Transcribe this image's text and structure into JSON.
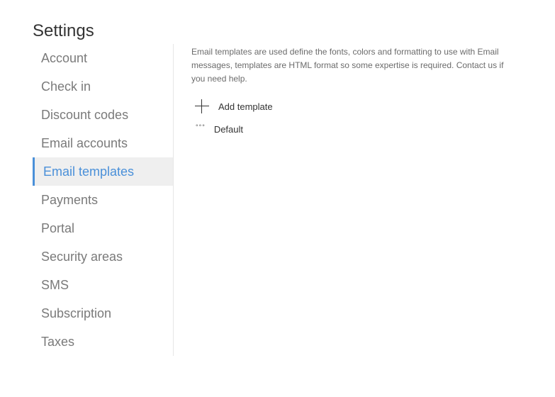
{
  "page": {
    "title": "Settings"
  },
  "sidebar": {
    "items": [
      {
        "label": "Account",
        "active": false
      },
      {
        "label": "Check in",
        "active": false
      },
      {
        "label": "Discount codes",
        "active": false
      },
      {
        "label": "Email accounts",
        "active": false
      },
      {
        "label": "Email templates",
        "active": true
      },
      {
        "label": "Payments",
        "active": false
      },
      {
        "label": "Portal",
        "active": false
      },
      {
        "label": "Security areas",
        "active": false
      },
      {
        "label": "SMS",
        "active": false
      },
      {
        "label": "Subscription",
        "active": false
      },
      {
        "label": "Taxes",
        "active": false
      }
    ]
  },
  "main": {
    "description": "Email templates are used define the fonts, colors and formatting to use with Email messages, templates are HTML format so some expertise is required. Contact us if you need help.",
    "add_template_label": "Add template",
    "add_icon": "plus-icon",
    "templates": [
      {
        "label": "Default",
        "icon": "more-icon",
        "icon_glyph": "°°°"
      }
    ]
  },
  "colors": {
    "accent": "#4a90d9",
    "active_background": "#efefef",
    "muted_text": "#7a7a7a"
  }
}
